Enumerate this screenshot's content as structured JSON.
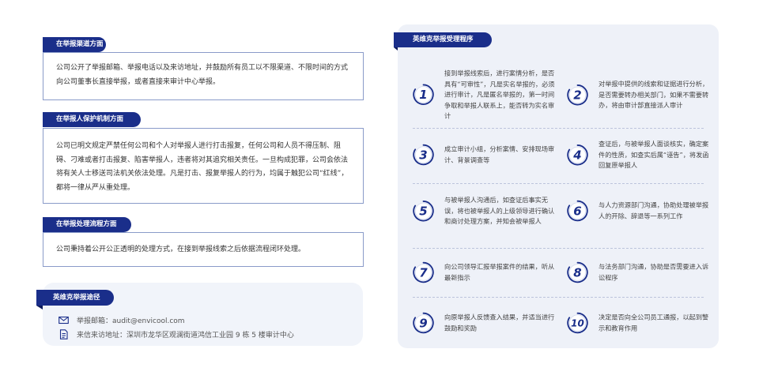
{
  "channels": {
    "title": "在举报渠道方面",
    "text": "公司公开了举报邮箱、举报电话以及来访地址，并鼓励所有员工以不限渠道、不限时间的方式向公司董事长直接举报，或者直接来审计中心举报。"
  },
  "protection": {
    "title": "在举报人保护机制方面",
    "text": "公司已明文规定严禁任何公司和个人对举报人进行打击报复，任何公司和人员不得压制、阻碍、刁难或者打击报复、陷害举报人，违者将对其追究相关责任。一旦构成犯罪，公司会依法将有关人士移送司法机关依法处理。凡是打击、报复举报人的行为，均属于触犯公司“红线”，都将一律从严从重处理。"
  },
  "process_aspect": {
    "title": "在举报处理流程方面",
    "text": "公司秉持着公开公正透明的处理方式，在接到举报线索之后依据流程闭环处理。"
  },
  "contact": {
    "title": "英维克举报途径",
    "email": "举报邮箱：audit@envicool.com",
    "address": "来信来访地址：深圳市龙华区观澜街道鸿信工业园 9 栋 5 楼审计中心",
    "email_icon": "mail-icon",
    "address_icon": "document-icon"
  },
  "procedure": {
    "title": "英维克举报受理程序",
    "steps": [
      {
        "num": "1",
        "text": "接到举报线索后，进行案情分析，是否具有“可审性”，凡是实名举报的，必须进行审计，凡是匿名举报的，第一时间争取和举报人联系上，能否转为实名审计"
      },
      {
        "num": "2",
        "text": "对举报中提供的线索和证据进行分析，是否需要转办相关部门，如果不需要转办，将由审计部直接派人审计"
      },
      {
        "num": "3",
        "text": "成立审计小组，分析案情、安排现场审计、背景调查等"
      },
      {
        "num": "4",
        "text": "查证后，与被举报人面谈核实，确定案件的性质，如查实后属“诬告”，将发函回复原举报人"
      },
      {
        "num": "5",
        "text": "与被举报人沟通后，如查证后事实无误，将也被举报人的上级领导进行确认和商讨处理方案，并知会被举报人"
      },
      {
        "num": "6",
        "text": "与人力资源部门沟通，协助处理被举报人的开除、辞退等一系列工作"
      },
      {
        "num": "7",
        "text": "向公司领导汇报举报案件的结果，听从最新指示"
      },
      {
        "num": "8",
        "text": "与法务部门沟通，协助是否需要进入诉讼程序"
      },
      {
        "num": "9",
        "text": "向原举报人反馈查入结果，并适当进行鼓励和奖励"
      },
      {
        "num": "10",
        "text": "决定是否向全公司员工通报，以起到警示和教育作用"
      }
    ]
  },
  "colors": {
    "navy": "#1a2e8a",
    "border": "#8a9bc9",
    "panel": "#eef1f8"
  }
}
